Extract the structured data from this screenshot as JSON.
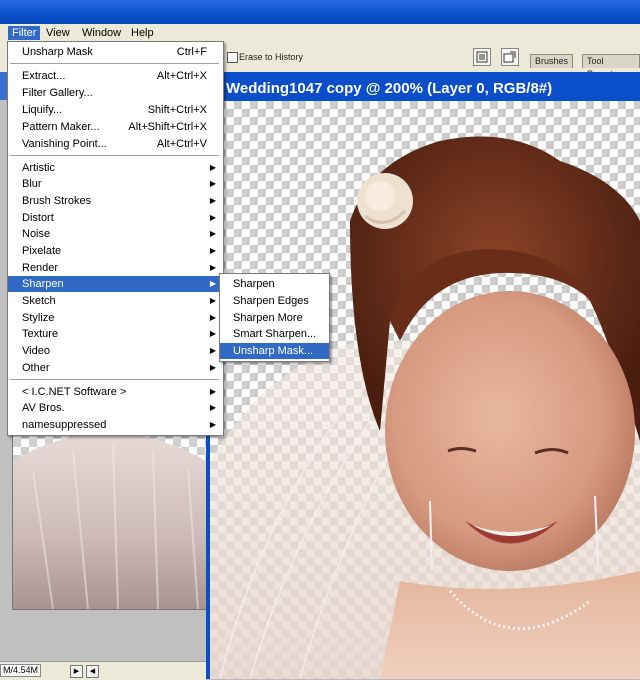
{
  "menubar": {
    "items": [
      "Filter",
      "View",
      "Window",
      "Help"
    ]
  },
  "options_bar": {
    "erase_to_history": "Erase to History",
    "well_tabs": [
      "Brushes",
      "Tool Presets"
    ]
  },
  "document": {
    "title": "Wedding1047 copy @ 200% (Layer 0, RGB/8#)"
  },
  "status": {
    "text": "M/4.54M"
  },
  "filter_menu": {
    "items": [
      {
        "label": "Unsharp Mask",
        "shortcut": "Ctrl+F"
      },
      {
        "label": "Extract...",
        "shortcut": "Alt+Ctrl+X"
      },
      {
        "label": "Filter Gallery...",
        "shortcut": ""
      },
      {
        "label": "Liquify...",
        "shortcut": "Shift+Ctrl+X"
      },
      {
        "label": "Pattern Maker...",
        "shortcut": "Alt+Shift+Ctrl+X"
      },
      {
        "label": "Vanishing Point...",
        "shortcut": "Alt+Ctrl+V"
      },
      {
        "label": "Artistic"
      },
      {
        "label": "Blur"
      },
      {
        "label": "Brush Strokes"
      },
      {
        "label": "Distort"
      },
      {
        "label": "Noise"
      },
      {
        "label": "Pixelate"
      },
      {
        "label": "Render"
      },
      {
        "label": "Sharpen"
      },
      {
        "label": "Sketch"
      },
      {
        "label": "Stylize"
      },
      {
        "label": "Texture"
      },
      {
        "label": "Video"
      },
      {
        "label": "Other"
      },
      {
        "label": "< I.C.NET Software >"
      },
      {
        "label": "AV Bros."
      },
      {
        "label": "namesuppressed"
      }
    ]
  },
  "sharpen_submenu": {
    "items": [
      "Sharpen",
      "Sharpen Edges",
      "Sharpen More",
      "Smart Sharpen...",
      "Unsharp Mask..."
    ]
  },
  "colors": {
    "highlight": "#316ac5",
    "titlebar": "#0a4fc9",
    "menu_bg": "#ece9d8"
  }
}
